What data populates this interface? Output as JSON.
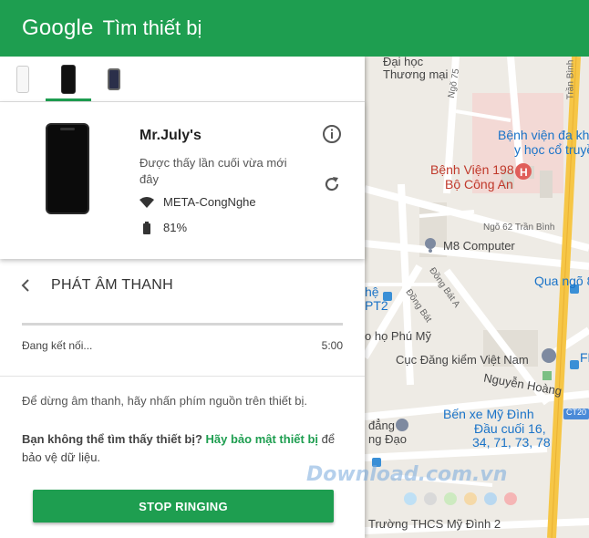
{
  "header": {
    "logo": "Google",
    "title": "Tìm thiết bị",
    "bg_color": "#1e9e50"
  },
  "device_tabs": [
    {
      "name": "white-phone",
      "active": false
    },
    {
      "name": "black-phone",
      "active": true
    },
    {
      "name": "dark-phone",
      "active": false
    }
  ],
  "device": {
    "name": "Mr.July's",
    "last_seen": "Được thấy lần cuối vừa mới đây",
    "network": "META-CongNghe",
    "battery": "81%",
    "info_icon": "info-icon",
    "refresh_icon": "refresh-icon"
  },
  "sound": {
    "title": "PHÁT ÂM THANH",
    "status": "Đang kết nối...",
    "timer": "5:00",
    "progress": 0,
    "hint": "Để dừng âm thanh, hãy nhấn phím nguồn trên thiết bị.",
    "secure_prefix": "Bạn không thể tìm thấy thiết bị?",
    "secure_link": "Hãy bảo mật thiết bị",
    "secure_suffix": " để bảo vệ dữ liệu.",
    "stop_label": "STOP RINGING"
  },
  "map": {
    "labels": {
      "dai_hoc": "Đại học",
      "thuong_mai": "Thương mại",
      "ngo75": "Ngõ 75",
      "tran_binh_top": "Trần Bình",
      "benh_vien_da": "Bệnh viện đa kh",
      "y_hoc": "y học cổ truyề",
      "benh_vien_198": "Bệnh Viện 198",
      "bo_cong_an": "Bộ Công An",
      "ngo62": "Ngõ 62 Trần Bình",
      "m8": "M8 Computer",
      "dong_bat_a": "Đồng Bát A",
      "dong_bat": "Đồng Bát",
      "qua_ngo": "Qua ngõ 8",
      "he": "hệ",
      "pt2": "PT2",
      "phu_my": "o họ Phú Mỹ",
      "dang_kiem": "Cục Đăng kiểm Việt Nam",
      "fl": "FL",
      "nguyen_hoang": "Nguyễn Hoàng",
      "ct20": "CT20",
      "ben_xe": "Bến xe Mỹ Đình",
      "dau_cuoi": "Đầu cuối 16,",
      "routes": "34, 71, 73, 78",
      "dang": "đẳng",
      "ng_dao": "ng Đạo",
      "thcs": "Trường THCS Mỹ Đình 2"
    },
    "watermark": "Download.com.vn",
    "dot_colors": [
      "#bfe0f5",
      "#d9d9d9",
      "#cdeac0",
      "#f5d9a8",
      "#b9d8f0",
      "#f5b5b5"
    ]
  }
}
